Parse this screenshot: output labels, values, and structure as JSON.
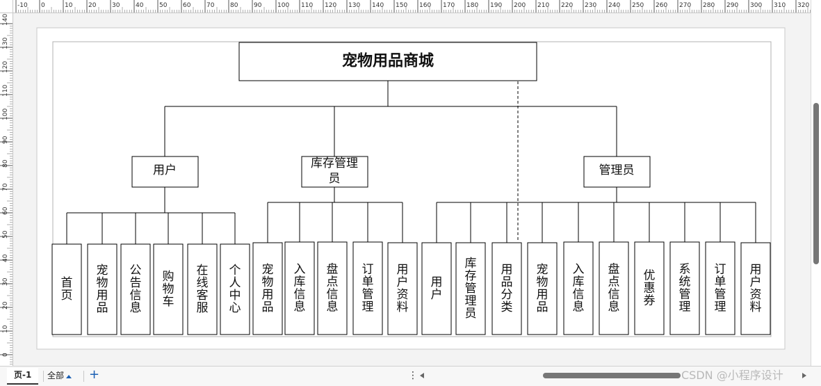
{
  "ruler": {
    "top_labels": [
      "-10",
      "0",
      "10",
      "20",
      "30",
      "40",
      "50",
      "60",
      "70",
      "80",
      "90",
      "100",
      "110",
      "120",
      "130",
      "140",
      "150",
      "160",
      "170",
      "180",
      "190",
      "200",
      "210",
      "220",
      "230",
      "240",
      "250",
      "260",
      "270",
      "280",
      "290",
      "300",
      "310",
      "320"
    ],
    "left_labels": [
      "140",
      "130",
      "120",
      "110",
      "100",
      "90",
      "80",
      "70",
      "60",
      "50",
      "40",
      "30",
      "20",
      "10",
      "0"
    ]
  },
  "diagram": {
    "root": "宠物用品商城",
    "roles": [
      "用户",
      "库存管理员",
      "管理员"
    ],
    "user_modules": [
      "首页",
      "宠物用品",
      "公告信息",
      "购物车",
      "在线客服",
      "个人中心"
    ],
    "stock_modules": [
      "宠物用品",
      "入库信息",
      "盘点信息",
      "订单管理",
      "用户资料"
    ],
    "admin_modules": [
      "用户",
      "库存管理员",
      "用品分类",
      "宠物用品",
      "入库信息",
      "盘点信息",
      "优惠券",
      "系统管理",
      "订单管理",
      "用户资料"
    ]
  },
  "statusbar": {
    "page_tab": "页-1",
    "all_tab": "全部",
    "add_tab": "+",
    "more": "⋮",
    "watermark": "CSDN @小程序设计"
  },
  "colors": {
    "canvas": "#f3f3f3",
    "page": "#ffffff",
    "stroke": "#000000",
    "accent": "#1a5fb4"
  }
}
